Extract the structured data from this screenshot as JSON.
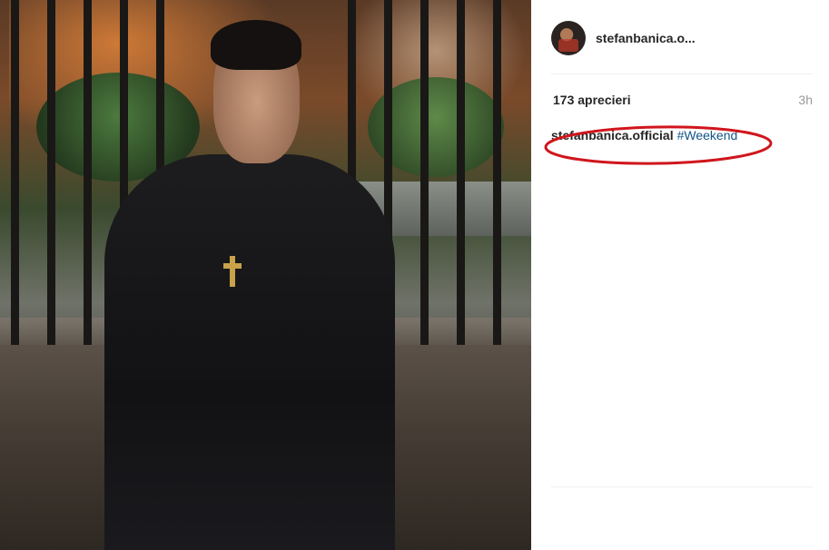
{
  "post": {
    "username_short": "stefanbanica.o...",
    "likes": "173 aprecieri",
    "time": "3h",
    "caption_user": "stefanbanica.official",
    "caption_tag": "#Weekend"
  },
  "colors": {
    "tag": "#125688",
    "annotation": "#d0161c"
  }
}
